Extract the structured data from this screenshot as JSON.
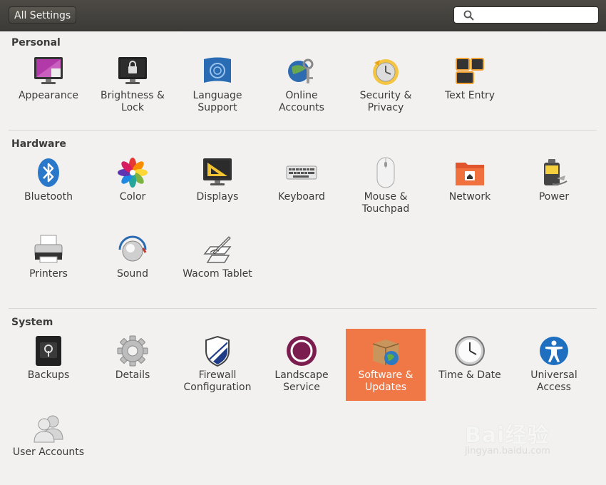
{
  "header": {
    "all_settings_label": "All Settings",
    "search_placeholder": ""
  },
  "sections": {
    "personal": "Personal",
    "hardware": "Hardware",
    "system": "System"
  },
  "items": {
    "appearance": {
      "label": "Appearance",
      "icon": "appearance-icon"
    },
    "brightness": {
      "label1": "Brightness &",
      "label2": "Lock",
      "icon": "brightness-lock-icon"
    },
    "language": {
      "label1": "Language",
      "label2": "Support",
      "icon": "language-support-icon"
    },
    "online": {
      "label1": "Online",
      "label2": "Accounts",
      "icon": "online-accounts-icon"
    },
    "security": {
      "label1": "Security &",
      "label2": "Privacy",
      "icon": "security-privacy-icon"
    },
    "textentry": {
      "label": "Text Entry",
      "icon": "text-entry-icon"
    },
    "bluetooth": {
      "label": "Bluetooth",
      "icon": "bluetooth-icon"
    },
    "color": {
      "label": "Color",
      "icon": "color-icon"
    },
    "displays": {
      "label": "Displays",
      "icon": "displays-icon"
    },
    "keyboard": {
      "label": "Keyboard",
      "icon": "keyboard-icon"
    },
    "mouse": {
      "label1": "Mouse &",
      "label2": "Touchpad",
      "icon": "mouse-icon"
    },
    "network": {
      "label": "Network",
      "icon": "network-icon"
    },
    "power": {
      "label": "Power",
      "icon": "power-icon"
    },
    "printers": {
      "label": "Printers",
      "icon": "printer-icon"
    },
    "sound": {
      "label": "Sound",
      "icon": "sound-icon"
    },
    "wacom": {
      "label": "Wacom Tablet",
      "icon": "wacom-tablet-icon"
    },
    "backups": {
      "label": "Backups",
      "icon": "backups-icon"
    },
    "details": {
      "label": "Details",
      "icon": "details-gear-icon"
    },
    "firewall": {
      "label1": "Firewall",
      "label2": "Configuration",
      "icon": "firewall-shield-icon"
    },
    "landscape": {
      "label1": "Landscape",
      "label2": "Service",
      "icon": "landscape-icon"
    },
    "software": {
      "label1": "Software &",
      "label2": "Updates",
      "icon": "software-updates-icon",
      "selected": true
    },
    "timedate": {
      "label": "Time & Date",
      "icon": "clock-icon"
    },
    "universal": {
      "label1": "Universal",
      "label2": "Access",
      "icon": "universal-access-icon"
    },
    "users": {
      "label": "User Accounts",
      "icon": "user-accounts-icon"
    }
  },
  "colors": {
    "accent": "#f07746",
    "header_bg": "#3c3b37",
    "window_bg": "#f2f1f0"
  },
  "watermark": {
    "line1": "Bai经验",
    "line2": "jingyan.baidu.com"
  }
}
